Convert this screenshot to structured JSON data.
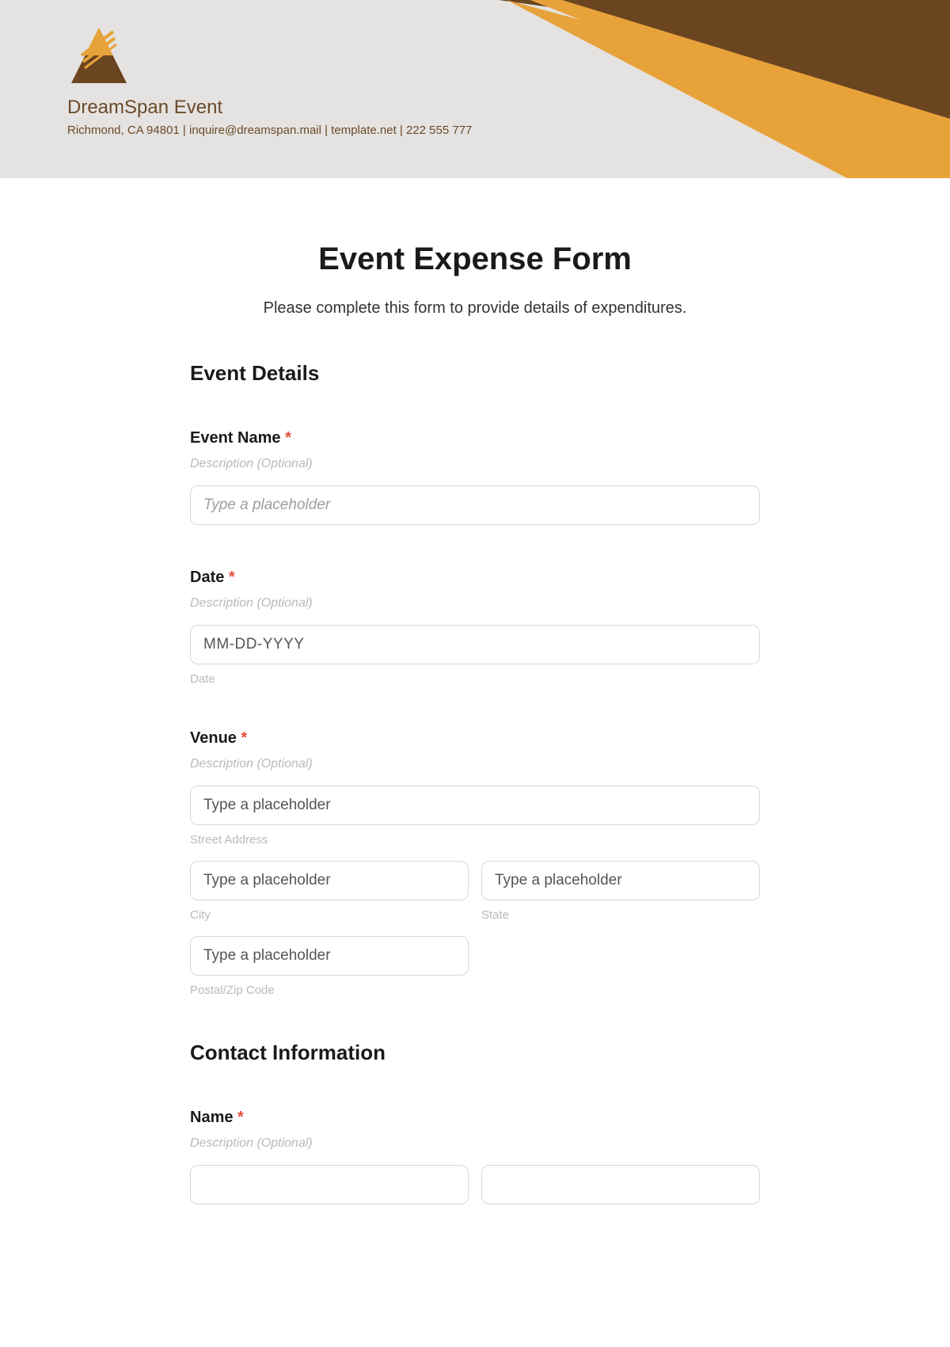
{
  "header": {
    "company": "DreamSpan Event",
    "meta": "Richmond, CA 94801 | inquire@dreamspan.mail | template.net | 222 555 777"
  },
  "form": {
    "title": "Event Expense Form",
    "subtitle": "Please complete this form to provide details of expenditures."
  },
  "sections": {
    "event_details": "Event Details",
    "contact_info": "Contact Information"
  },
  "fields": {
    "event_name": {
      "label": "Event Name",
      "desc": "Description (Optional)",
      "placeholder": "Type a placeholder"
    },
    "date": {
      "label": "Date",
      "desc": "Description (Optional)",
      "placeholder": "MM-DD-YYYY",
      "sublabel": "Date"
    },
    "venue": {
      "label": "Venue",
      "desc": "Description (Optional)",
      "street_ph": "Type a placeholder",
      "street_lbl": "Street Address",
      "city_ph": "Type a placeholder",
      "city_lbl": "City",
      "state_ph": "Type a placeholder",
      "state_lbl": "State",
      "zip_ph": "Type a placeholder",
      "zip_lbl": "Postal/Zip Code"
    },
    "name": {
      "label": "Name",
      "desc": "Description (Optional)"
    }
  },
  "required_marker": "*"
}
